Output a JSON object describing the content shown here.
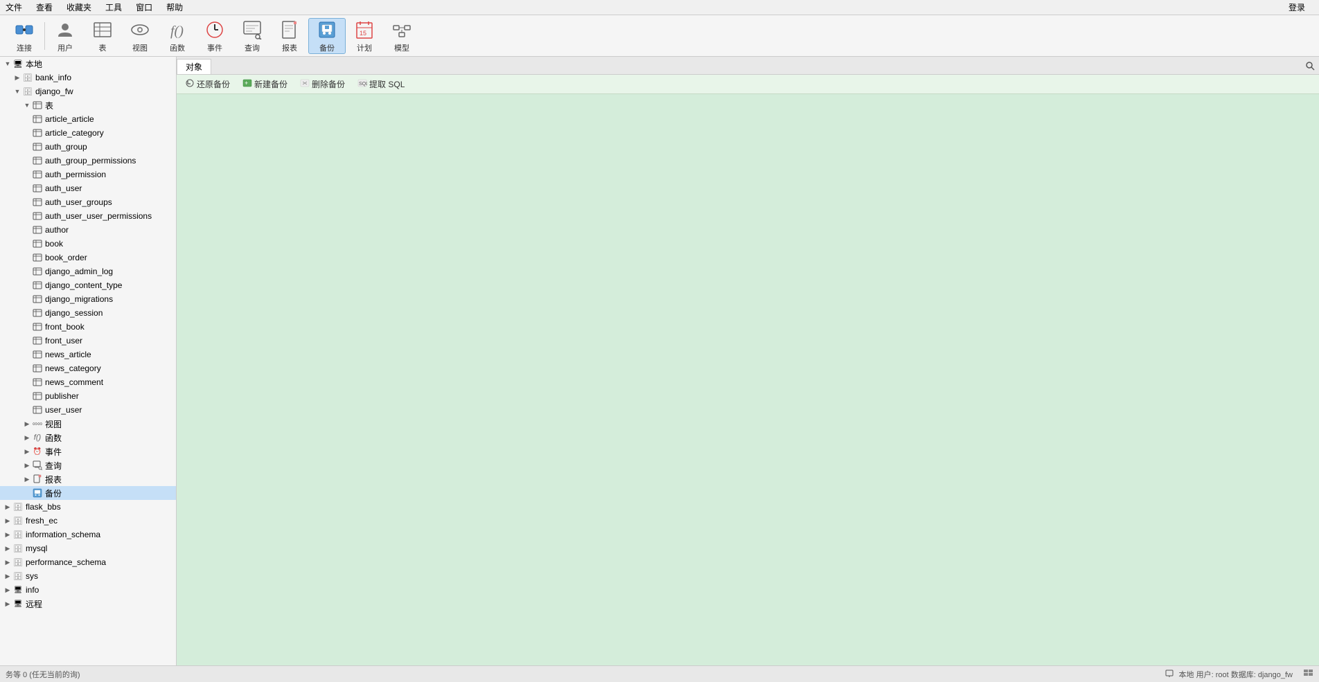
{
  "menubar": {
    "items": [
      "文件",
      "查看",
      "收藏夹",
      "工具",
      "窗口",
      "帮助",
      "登录"
    ]
  },
  "toolbar": {
    "items": [
      {
        "label": "连接",
        "icon": "🔌",
        "active": false
      },
      {
        "label": "用户",
        "icon": "👤",
        "active": false
      },
      {
        "label": "表",
        "icon": "📋",
        "active": false
      },
      {
        "label": "视图",
        "icon": "👁",
        "active": false
      },
      {
        "label": "函数",
        "icon": "ƒ",
        "active": false
      },
      {
        "label": "事件",
        "icon": "⏰",
        "active": false
      },
      {
        "label": "查询",
        "icon": "🔍",
        "active": false
      },
      {
        "label": "报表",
        "icon": "📊",
        "active": false
      },
      {
        "label": "备份",
        "icon": "💾",
        "active": true
      },
      {
        "label": "计划",
        "icon": "📅",
        "active": false
      },
      {
        "label": "模型",
        "icon": "📐",
        "active": false
      }
    ]
  },
  "sidebar": {
    "local_label": "本地",
    "remote_label": "远程",
    "databases": [
      {
        "name": "bank_info",
        "level": 1,
        "expanded": false,
        "type": "db"
      },
      {
        "name": "django_fw",
        "level": 1,
        "expanded": true,
        "type": "db"
      },
      {
        "name": "表",
        "level": 2,
        "expanded": true,
        "type": "folder"
      },
      {
        "name": "article_article",
        "level": 3,
        "type": "table"
      },
      {
        "name": "article_category",
        "level": 3,
        "type": "table"
      },
      {
        "name": "auth_group",
        "level": 3,
        "type": "table"
      },
      {
        "name": "auth_group_permissions",
        "level": 3,
        "type": "table"
      },
      {
        "name": "auth_permission",
        "level": 3,
        "type": "table"
      },
      {
        "name": "auth_user",
        "level": 3,
        "type": "table"
      },
      {
        "name": "auth_user_groups",
        "level": 3,
        "type": "table"
      },
      {
        "name": "auth_user_user_permissions",
        "level": 3,
        "type": "table"
      },
      {
        "name": "author",
        "level": 3,
        "type": "table"
      },
      {
        "name": "book",
        "level": 3,
        "type": "table"
      },
      {
        "name": "book_order",
        "level": 3,
        "type": "table"
      },
      {
        "name": "django_admin_log",
        "level": 3,
        "type": "table"
      },
      {
        "name": "django_content_type",
        "level": 3,
        "type": "table"
      },
      {
        "name": "django_migrations",
        "level": 3,
        "type": "table"
      },
      {
        "name": "django_session",
        "level": 3,
        "type": "table"
      },
      {
        "name": "front_book",
        "level": 3,
        "type": "table"
      },
      {
        "name": "front_user",
        "level": 3,
        "type": "table"
      },
      {
        "name": "news_article",
        "level": 3,
        "type": "table"
      },
      {
        "name": "news_category",
        "level": 3,
        "type": "table"
      },
      {
        "name": "news_comment",
        "level": 3,
        "type": "table"
      },
      {
        "name": "publisher",
        "level": 3,
        "type": "table"
      },
      {
        "name": "user_user",
        "level": 3,
        "type": "table"
      },
      {
        "name": "视图",
        "level": 2,
        "expanded": false,
        "type": "folder"
      },
      {
        "name": "函数",
        "level": 2,
        "expanded": false,
        "type": "folder"
      },
      {
        "name": "事件",
        "level": 2,
        "expanded": false,
        "type": "folder"
      },
      {
        "name": "查询",
        "level": 2,
        "expanded": false,
        "type": "folder"
      },
      {
        "name": "报表",
        "level": 2,
        "expanded": false,
        "type": "folder"
      },
      {
        "name": "备份",
        "level": 2,
        "expanded": false,
        "type": "folder",
        "selected": true
      },
      {
        "name": "flask_bbs",
        "level": 1,
        "expanded": false,
        "type": "db"
      },
      {
        "name": "fresh_ec",
        "level": 1,
        "expanded": false,
        "type": "db"
      },
      {
        "name": "information_schema",
        "level": 1,
        "expanded": false,
        "type": "db"
      },
      {
        "name": "mysql",
        "level": 1,
        "expanded": false,
        "type": "db"
      },
      {
        "name": "performance_schema",
        "level": 1,
        "expanded": false,
        "type": "db"
      },
      {
        "name": "sys",
        "level": 1,
        "expanded": false,
        "type": "db"
      },
      {
        "name": "info",
        "level": 0,
        "expanded": false,
        "type": "db"
      }
    ]
  },
  "tabs": {
    "object_tab": "对象"
  },
  "actions": {
    "restore": "还原备份",
    "new_backup": "新建备份",
    "delete_backup": "删除备份",
    "extract_sql": "提取 SQL"
  },
  "statusbar": {
    "left": "务等 0 (任无当前的询)",
    "middle_icon": "本地",
    "middle_text": "用户: root  数据库: django_fw",
    "right": ""
  }
}
